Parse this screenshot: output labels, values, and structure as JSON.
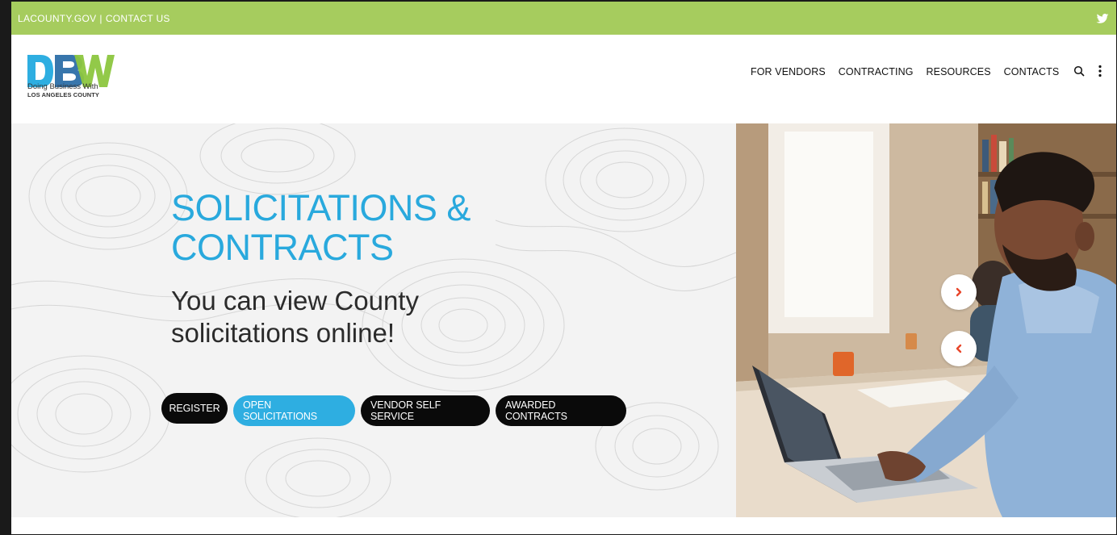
{
  "topbar": {
    "link1": "LACOUNTY.GOV",
    "separator": "|",
    "link2": "CONTACT US",
    "social_icon": "twitter-icon"
  },
  "logo": {
    "line1": "Doing Business With",
    "line2": "LOS ANGELES COUNTY",
    "letters": "DBW"
  },
  "nav": {
    "items": [
      "FOR VENDORS",
      "CONTRACTING",
      "RESOURCES",
      "CONTACTS"
    ],
    "icons": [
      "search-icon",
      "more-vertical-icon"
    ]
  },
  "hero": {
    "title_line1": "SOLICITATIONS &",
    "title_line2": "CONTRACTS",
    "subtitle_line1": "You can view County",
    "subtitle_line2": "solicitations online!",
    "buttons": [
      "REGISTER",
      "OPEN SOLICITATIONS",
      "VENDOR SELF SERVICE",
      "AWARDED CONTRACTS"
    ]
  },
  "slider": {
    "next_icon": "chevron-right-icon",
    "prev_icon": "chevron-left-icon"
  },
  "colors": {
    "topbar": "#a6cc5e",
    "accent_blue": "#29a9dd",
    "button_dark": "#0a0a0a",
    "slider_arrow": "#e8462a"
  }
}
